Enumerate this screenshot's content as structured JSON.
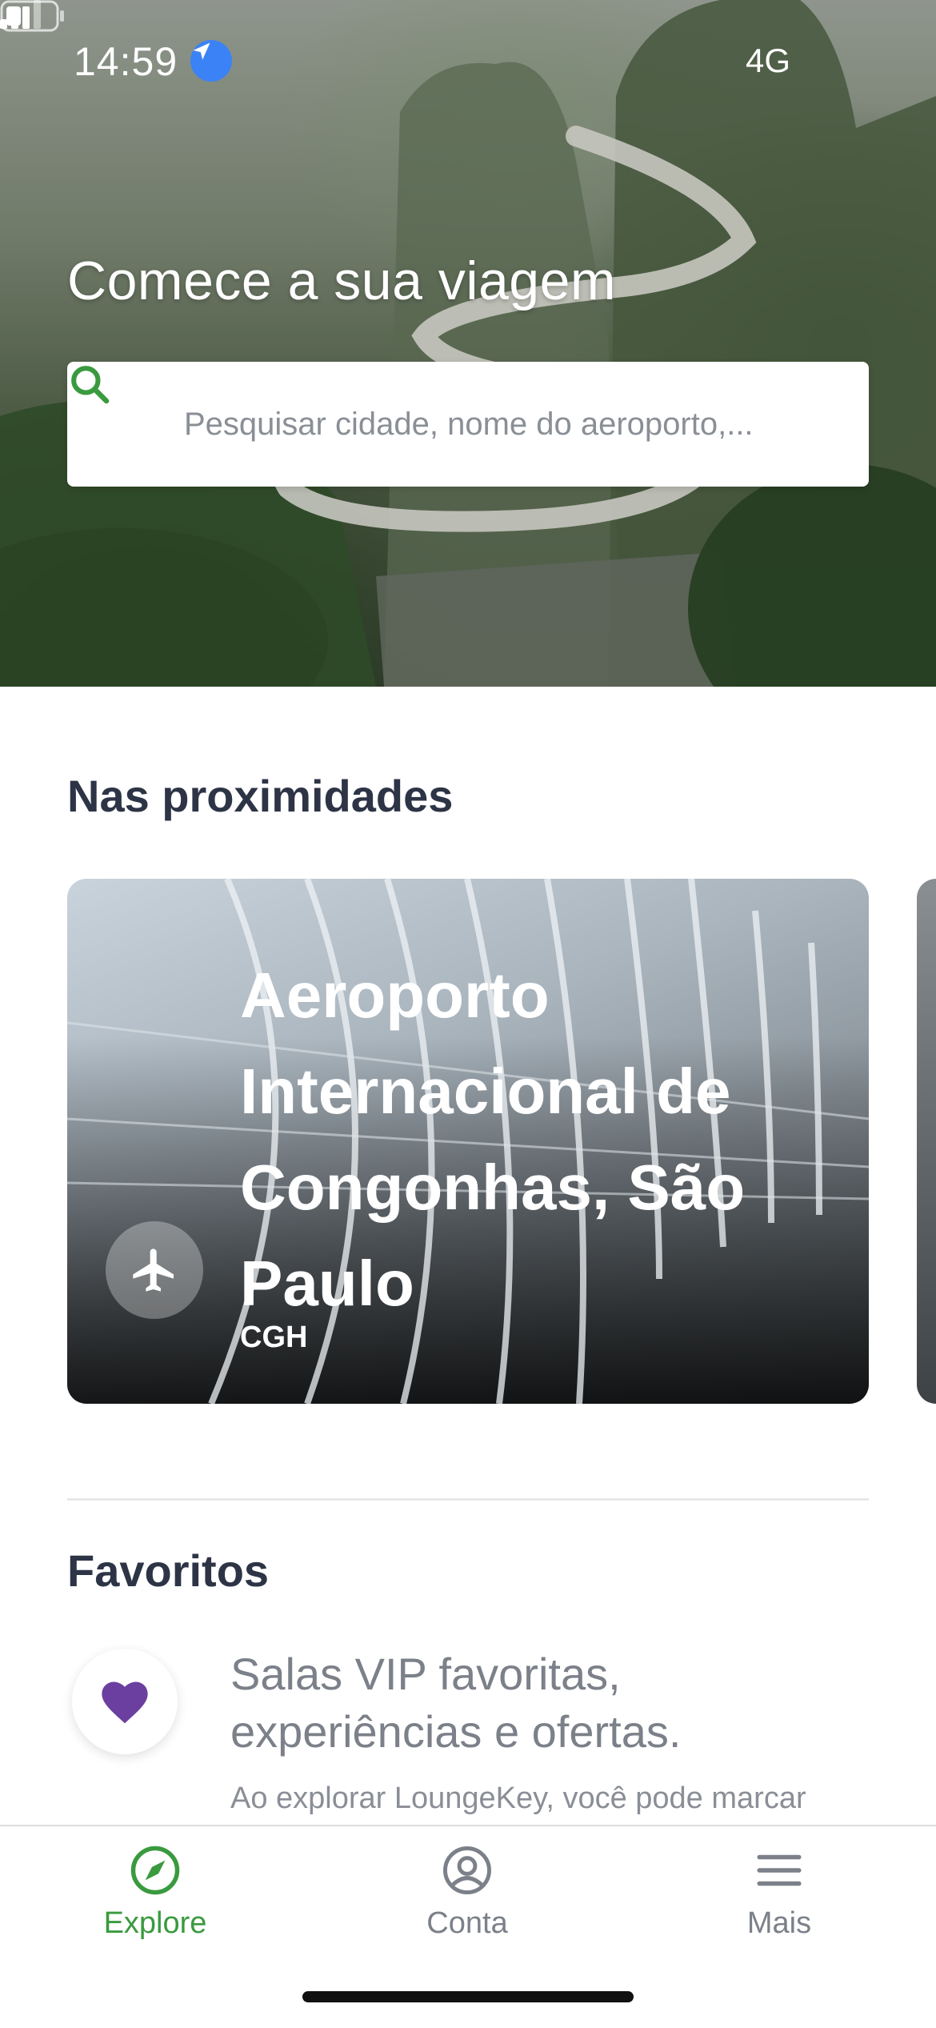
{
  "status_bar": {
    "time": "14:59",
    "network": "4G"
  },
  "hero": {
    "title": "Comece a sua viagem",
    "search_placeholder": "Pesquisar cidade, nome do aeroporto,..."
  },
  "nearby": {
    "title": "Nas proximidades",
    "cards": [
      {
        "name": "Aeroporto Internacional de Congonhas, São Paulo",
        "code": "CGH",
        "icon": "plane-icon"
      }
    ]
  },
  "favorites": {
    "title": "Favoritos",
    "headline": "Salas VIP favoritas, experiências e ofertas.",
    "body": "Ao explorar LoungeKey, você pode marcar",
    "icon": "heart-icon",
    "icon_color": "#6b3fa0"
  },
  "tabbar": {
    "items": [
      {
        "label": "Explore",
        "icon": "compass-icon",
        "active": true
      },
      {
        "label": "Conta",
        "icon": "user-circle-icon",
        "active": false
      },
      {
        "label": "Mais",
        "icon": "menu-icon",
        "active": false
      }
    ],
    "active_color": "#3a9a3f",
    "inactive_color": "#7b8089"
  }
}
